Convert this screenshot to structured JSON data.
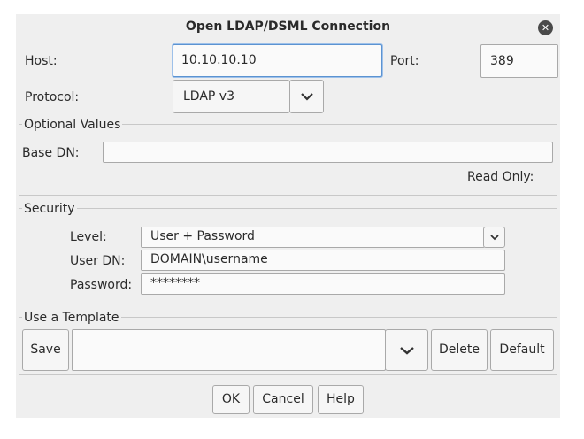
{
  "window": {
    "title": "Open LDAP/DSML Connection",
    "close_icon": "close-icon"
  },
  "connection": {
    "host_label": "Host:",
    "host_value": "10.10.10.10",
    "port_label": "Port:",
    "port_value": "389",
    "protocol_label": "Protocol:",
    "protocol_value": "LDAP v3",
    "dropdown_icon": "chevron-down-icon"
  },
  "optional_values": {
    "legend": "Optional Values",
    "base_dn_label": "Base DN:",
    "base_dn_value": "",
    "read_only_label": "Read Only:"
  },
  "security": {
    "legend": "Security",
    "level_label": "Level:",
    "level_value": "User + Password",
    "user_dn_label": "User DN:",
    "user_dn_value": "DOMAIN\\username",
    "password_label": "Password:",
    "password_value": "********"
  },
  "template": {
    "legend": "Use a Template",
    "save_label": "Save",
    "template_value": "",
    "delete_label": "Delete",
    "default_label": "Default"
  },
  "footer": {
    "ok_label": "OK",
    "cancel_label": "Cancel",
    "help_label": "Help"
  }
}
